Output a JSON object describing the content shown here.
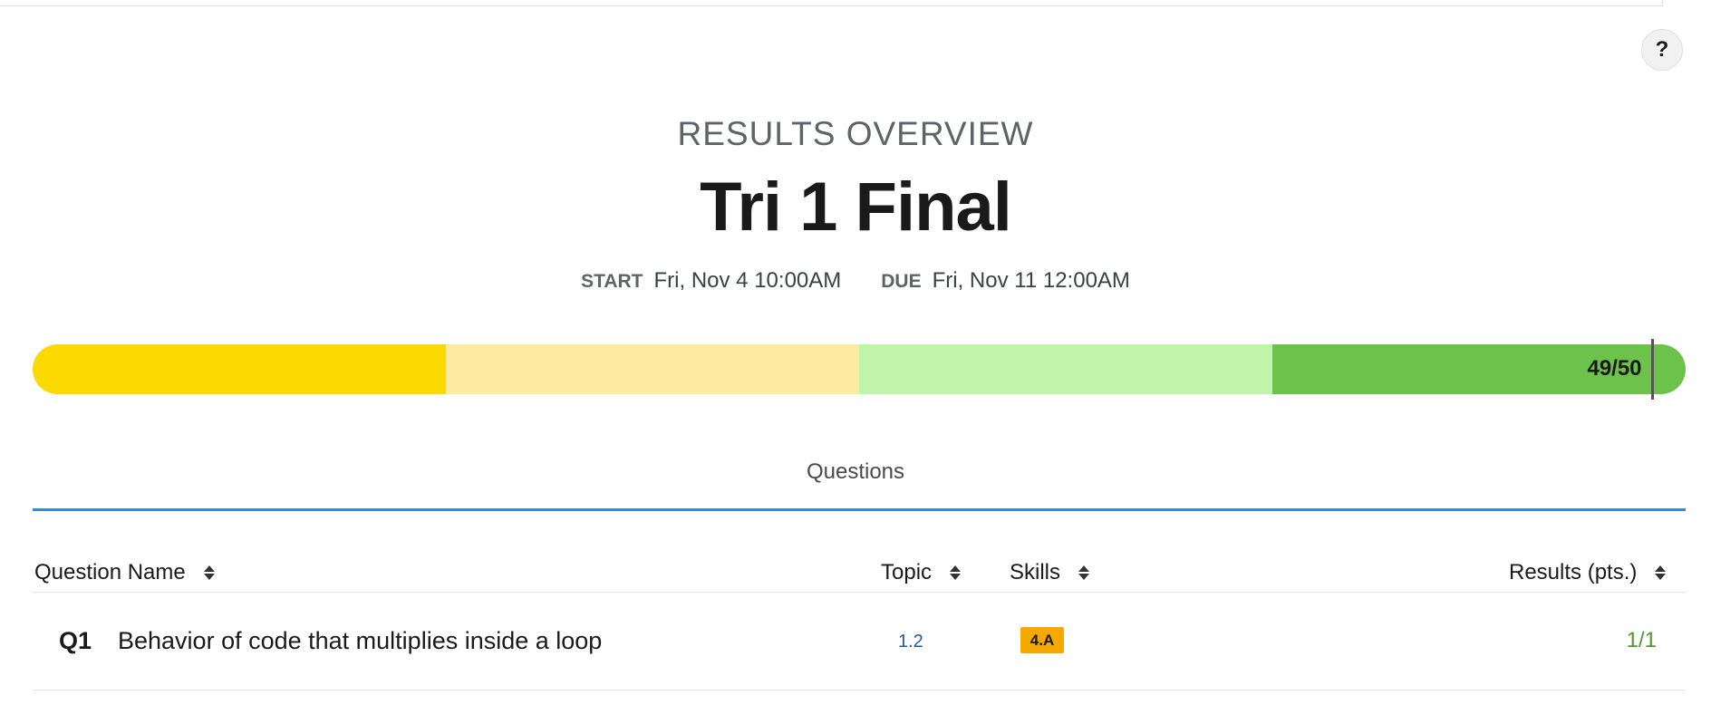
{
  "header": {
    "help_label": "?",
    "eyebrow": "RESULTS OVERVIEW",
    "title": "Tri 1 Final",
    "start_label": "START",
    "start_value": "Fri, Nov 4 10:00AM",
    "due_label": "DUE",
    "due_value": "Fri, Nov 11 12:00AM"
  },
  "progress": {
    "label": "49/50",
    "score": 49,
    "total": 50,
    "segment_colors": [
      "#fcd900",
      "#fdeca0",
      "#c0f4aa",
      "#6cc24a"
    ]
  },
  "tabs": [
    {
      "label": "Questions",
      "active": true,
      "underline_color": "#2f8bd8"
    }
  ],
  "table": {
    "columns": [
      {
        "label": "Question Name"
      },
      {
        "label": "Topic"
      },
      {
        "label": "Skills"
      },
      {
        "label": "Results (pts.)"
      }
    ],
    "rows": [
      {
        "id": "Q1",
        "name": "Behavior of code that multiplies inside a loop",
        "topic": "1.2",
        "skill": "4.A",
        "result": "1/1"
      }
    ]
  },
  "colors": {
    "skill_badge": "#f5a800",
    "result_text": "#4f9a2a",
    "topic_text": "#1f5fa0"
  }
}
